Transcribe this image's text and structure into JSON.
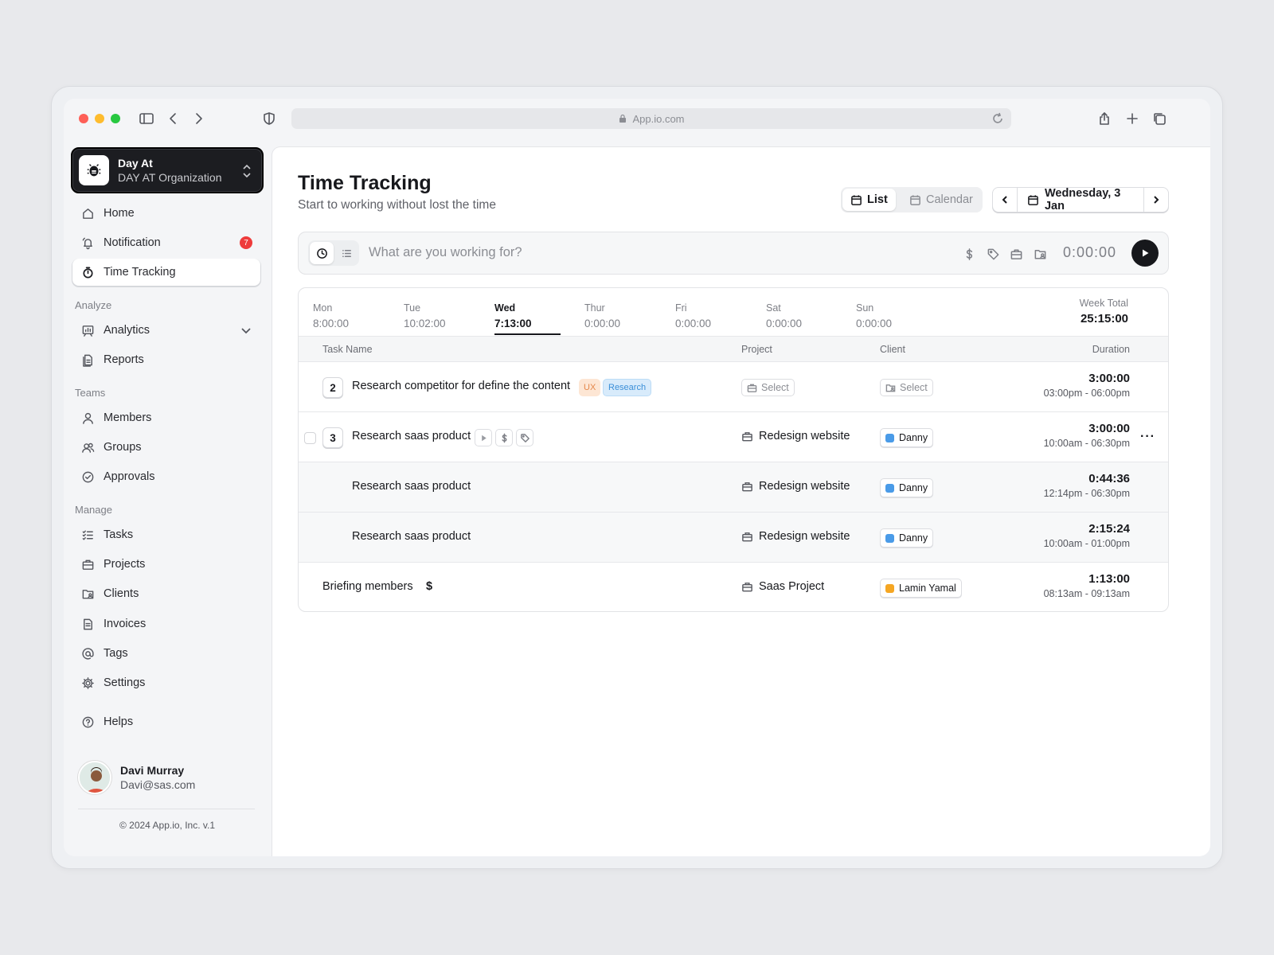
{
  "browser": {
    "url": "App.io.com"
  },
  "org": {
    "name": "Day At",
    "sub": "DAY AT Organization"
  },
  "nav": {
    "home": "Home",
    "notification": "Notification",
    "notification_count": "7",
    "time_tracking": "Time Tracking",
    "analyze_label": "Analyze",
    "analytics": "Analytics",
    "reports": "Reports",
    "teams_label": "Teams",
    "members": "Members",
    "groups": "Groups",
    "approvals": "Approvals",
    "manage_label": "Manage",
    "tasks": "Tasks",
    "projects": "Projects",
    "clients": "Clients",
    "invoices": "Invoices",
    "tags": "Tags",
    "settings": "Settings",
    "helps": "Helps"
  },
  "user": {
    "name": "Davi Murray",
    "email": "Davi@sas.com"
  },
  "footer": {
    "copyright": "© 2024 App.io, Inc. v.1"
  },
  "header": {
    "title": "Time Tracking",
    "subtitle": "Start to working without lost the time",
    "view_list": "List",
    "view_calendar": "Calendar",
    "date": "Wednesday, 3 Jan"
  },
  "timer": {
    "placeholder": "What are you working for?",
    "time": "0:00:00"
  },
  "week": {
    "days": [
      {
        "name": "Mon",
        "value": "8:00:00"
      },
      {
        "name": "Tue",
        "value": "10:02:00"
      },
      {
        "name": "Wed",
        "value": "7:13:00"
      },
      {
        "name": "Thur",
        "value": "0:00:00"
      },
      {
        "name": "Fri",
        "value": "0:00:00"
      },
      {
        "name": "Sat",
        "value": "0:00:00"
      },
      {
        "name": "Sun",
        "value": "0:00:00"
      }
    ],
    "total_label": "Week Total",
    "total": "25:15:00"
  },
  "table": {
    "headers": {
      "task": "Task Name",
      "project": "Project",
      "client": "Client",
      "duration": "Duration"
    },
    "rows": [
      {
        "count": "2",
        "task": "Research competitor for define the content",
        "tags": [
          "UX",
          "Research"
        ],
        "project": "Select",
        "client": "Select",
        "duration": "3:00:00",
        "range": "03:00pm - 06:00pm"
      },
      {
        "count": "3",
        "task": "Research saas product",
        "project": "Redesign website",
        "client": "Danny",
        "duration": "3:00:00",
        "range": "10:00am - 06:30pm"
      },
      {
        "task": "Research saas product",
        "project": "Redesign website",
        "client": "Danny",
        "duration": "0:44:36",
        "range": "12:14pm - 06:30pm"
      },
      {
        "task": "Research saas product",
        "project": "Redesign website",
        "client": "Danny",
        "duration": "2:15:24",
        "range": "10:00am - 01:00pm"
      },
      {
        "task": "Briefing members",
        "billable": "$",
        "project": "Saas Project",
        "client": "Lamin Yamal",
        "duration": "1:13:00",
        "range": "08:13am - 09:13am"
      }
    ]
  },
  "colors": {
    "danny": "#4a9be8",
    "lamin": "#f5a623",
    "badge": "#ee3b3b",
    "accent": "#17181c"
  }
}
